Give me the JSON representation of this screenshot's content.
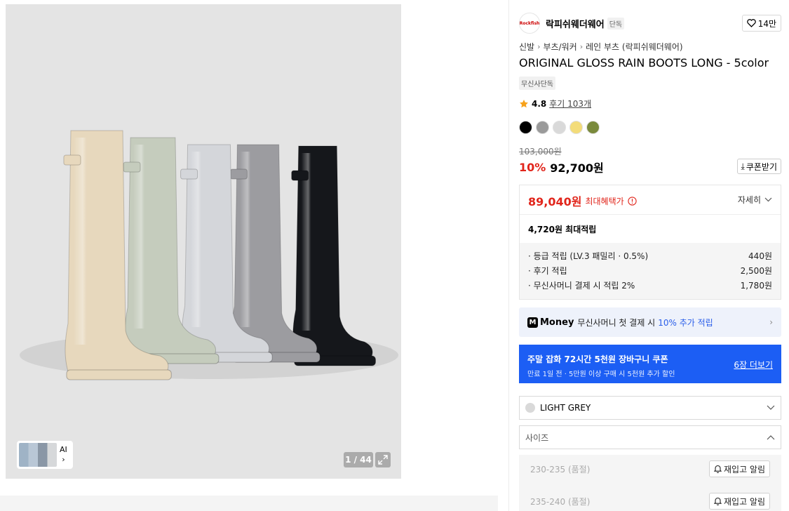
{
  "gallery": {
    "counter": "1 / 44",
    "thumb_label": "AI",
    "boot_colors": [
      "#e7d8bd",
      "#c5ccbd",
      "#d4d6da",
      "#9c9ca0",
      "#15171b"
    ]
  },
  "brand": {
    "name": "락피쉬웨더웨어",
    "tag": "단독",
    "likes": "14만",
    "logo_text": "Rockfish"
  },
  "breadcrumb": [
    "신발",
    "부츠/워커",
    "레인 부츠 (락피쉬웨더웨어)"
  ],
  "product": {
    "title": "ORIGINAL GLOSS RAIN BOOTS LONG - 5color",
    "exclusive_badge": "무신사단독",
    "rating": "4.8",
    "reviews": "후기 103개",
    "swatches": [
      "#000000",
      "#9a9a9a",
      "#d9d9d9",
      "#f3dc7a",
      "#7a8a3c"
    ],
    "original_price": "103,000원",
    "discount": "10%",
    "price": "92,700원",
    "coupon_button": "쿠폰받기"
  },
  "benefit": {
    "max_price": "89,040원",
    "max_label": "최대혜택가",
    "detail": "자세히",
    "points_max": "4,720원 최대적립",
    "points": [
      {
        "label": "· 등급 적립 (LV.3 패밀리 · 0.5%)",
        "value": "440원"
      },
      {
        "label": "· 후기 적립",
        "value": "2,500원"
      },
      {
        "label": "· 무신사머니 결제 시 적립 2%",
        "value": "1,780원"
      }
    ]
  },
  "money": {
    "logo": "M",
    "title": "Money",
    "text": "무신사머니 첫 결제 시",
    "highlight": "10% 추가 적립"
  },
  "coupon_banner": {
    "title": "주말 잡화 72시간 5천원 장바구니 쿠폰",
    "subtitle": "만료 1일 전 · 5만원 이상 구매 시 5천원 추가 할인",
    "more": "6장 더보기"
  },
  "options": {
    "color_value": "LIGHT GREY",
    "size_placeholder": "사이즈",
    "sizes": [
      {
        "label": "230-235 (품절)",
        "action": "재입고 알림"
      },
      {
        "label": "235-240 (품절)",
        "action": "재입고 알림"
      }
    ]
  }
}
